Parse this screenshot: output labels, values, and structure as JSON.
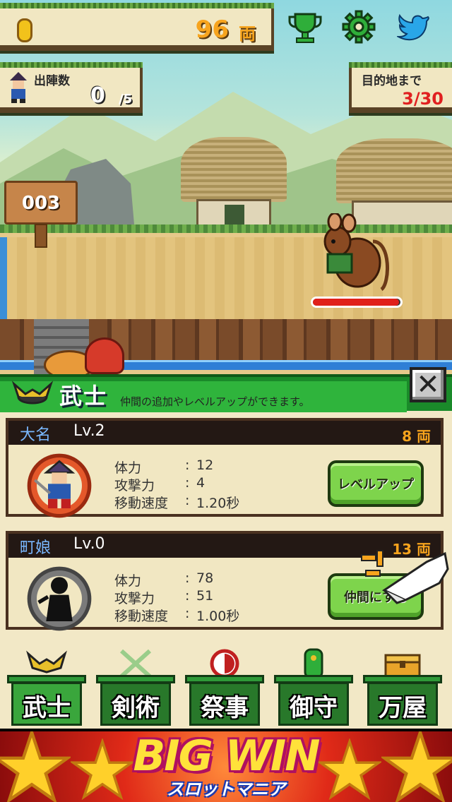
{
  "hud": {
    "coins": "96",
    "coin_unit": "両",
    "sortie_label": "出陣数",
    "sortie_count": "0",
    "sortie_max": "/5",
    "destination_label": "目的地まで",
    "destination_progress": "3/30"
  },
  "scene": {
    "stage_number": "003",
    "enemy_hp_fraction": 0.98
  },
  "panel": {
    "title": "武士",
    "subtitle": "仲間の追加やレベルアップができます。",
    "close_label": "✕",
    "units": [
      {
        "name": "大名",
        "level": "Lv.2",
        "cost": "8 両",
        "stats": [
          {
            "label": "体力",
            "value": "12"
          },
          {
            "label": "攻撃力",
            "value": "4"
          },
          {
            "label": "移動速度",
            "value": "1.20秒"
          }
        ],
        "action": "レベルアップ"
      },
      {
        "name": "町娘",
        "level": "Lv.0",
        "cost": "13 両",
        "stats": [
          {
            "label": "体力",
            "value": "78"
          },
          {
            "label": "攻撃力",
            "value": "51"
          },
          {
            "label": "移動速度",
            "value": "1.00秒"
          }
        ],
        "action": "仲間にする"
      }
    ]
  },
  "nav": {
    "tabs": [
      {
        "label": "武士",
        "icon": "kabuto-icon"
      },
      {
        "label": "剣術",
        "icon": "crossed-swords-icon"
      },
      {
        "label": "祭事",
        "icon": "festival-drum-icon"
      },
      {
        "label": "御守",
        "icon": "omamori-icon"
      },
      {
        "label": "万屋",
        "icon": "treasure-chest-icon"
      }
    ]
  },
  "banner": {
    "title": "BIG WIN",
    "subtitle": "スロットマニア"
  },
  "colors": {
    "gold": "#f7a41d",
    "panel_green": "#2fb43c",
    "destination_red": "#e02020"
  }
}
